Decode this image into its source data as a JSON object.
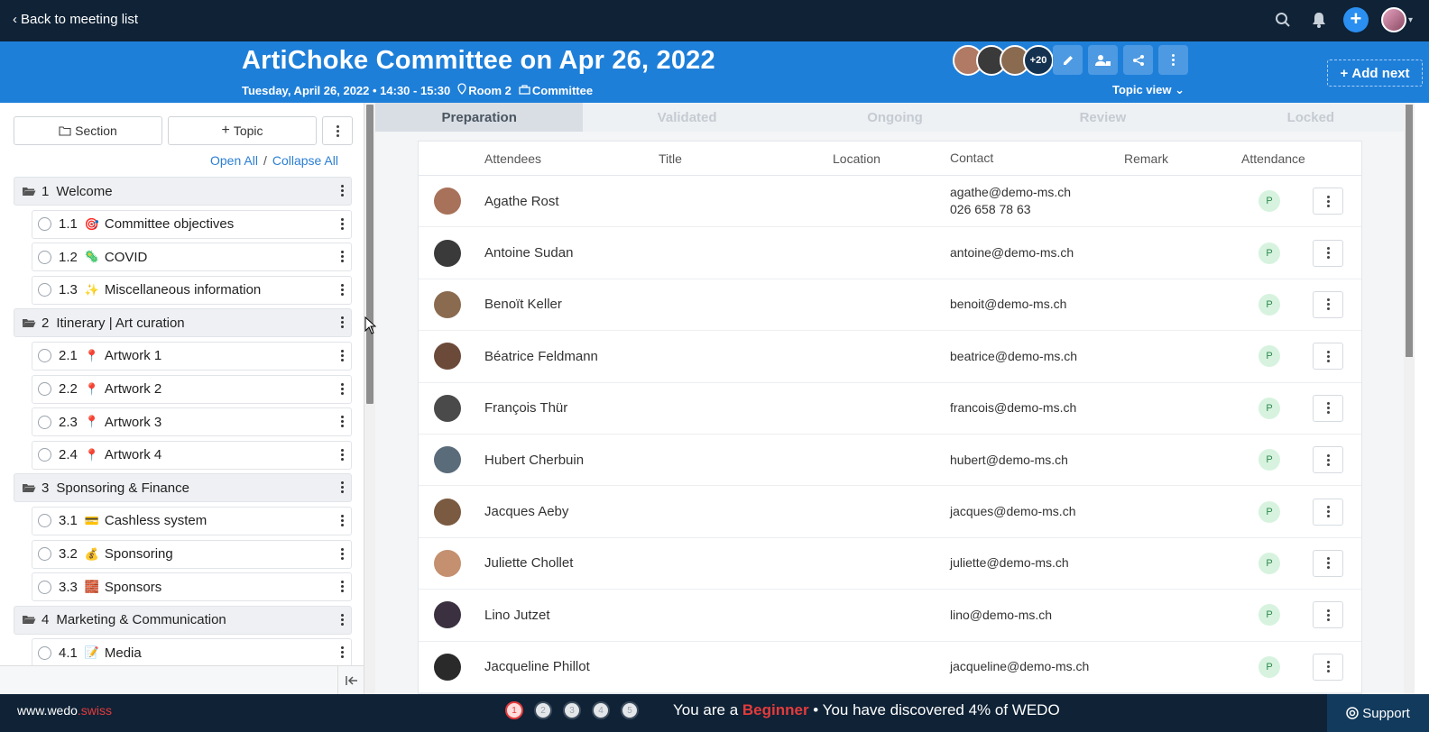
{
  "topbar": {
    "back_label": "Back to meeting list",
    "icons": [
      "search-icon",
      "bell-icon",
      "plus-icon",
      "user-avatar"
    ]
  },
  "header": {
    "title": "ArtiChoke Committee on Apr 26, 2022",
    "date_time": "Tuesday, April 26, 2022 • 14:30 - 15:30",
    "room": "Room 2",
    "category": "Committee",
    "more_attendees": "+20",
    "topic_view_label": "Topic view",
    "add_next_label": "Add next",
    "accent": "#1e7fd9"
  },
  "left": {
    "section_btn": "Section",
    "topic_btn": "Topic",
    "open_all": "Open All",
    "separator": "/",
    "collapse_all": "Collapse All",
    "tree": [
      {
        "type": "section",
        "num": "1",
        "label": "Welcome"
      },
      {
        "type": "topic",
        "num": "1.1",
        "emoji": "🎯",
        "label": "Committee objectives"
      },
      {
        "type": "topic",
        "num": "1.2",
        "emoji": "🦠",
        "label": "COVID"
      },
      {
        "type": "topic",
        "num": "1.3",
        "emoji": "✨",
        "label": "Miscellaneous information"
      },
      {
        "type": "section",
        "num": "2",
        "label": "Itinerary | Art curation"
      },
      {
        "type": "topic",
        "num": "2.1",
        "emoji": "📍",
        "label": "Artwork 1"
      },
      {
        "type": "topic",
        "num": "2.2",
        "emoji": "📍",
        "label": "Artwork 2"
      },
      {
        "type": "topic",
        "num": "2.3",
        "emoji": "📍",
        "label": "Artwork 3"
      },
      {
        "type": "topic",
        "num": "2.4",
        "emoji": "📍",
        "label": "Artwork 4"
      },
      {
        "type": "section",
        "num": "3",
        "label": "Sponsoring & Finance"
      },
      {
        "type": "topic",
        "num": "3.1",
        "emoji": "💳",
        "label": "Cashless system"
      },
      {
        "type": "topic",
        "num": "3.2",
        "emoji": "💰",
        "label": "Sponsoring"
      },
      {
        "type": "topic",
        "num": "3.3",
        "emoji": "🧱",
        "label": "Sponsors"
      },
      {
        "type": "section",
        "num": "4",
        "label": "Marketing & Communication"
      },
      {
        "type": "topic",
        "num": "4.1",
        "emoji": "📝",
        "label": "Media"
      }
    ]
  },
  "steps": [
    "Preparation",
    "Validated",
    "Ongoing",
    "Review",
    "Locked"
  ],
  "table": {
    "headers": [
      "Attendees",
      "Title",
      "Location",
      "Contact",
      "Remark",
      "Attendance"
    ],
    "rows": [
      {
        "name": "Agathe Rost",
        "email": "agathe@demo-ms.ch",
        "phone": "026 658 78 63",
        "attendance": "P"
      },
      {
        "name": "Antoine Sudan",
        "email": "antoine@demo-ms.ch",
        "phone": "",
        "attendance": "P"
      },
      {
        "name": "Benoït Keller",
        "email": "benoit@demo-ms.ch",
        "phone": "",
        "attendance": "P"
      },
      {
        "name": "Béatrice Feldmann",
        "email": "beatrice@demo-ms.ch",
        "phone": "",
        "attendance": "P"
      },
      {
        "name": "François Thür",
        "email": "francois@demo-ms.ch",
        "phone": "",
        "attendance": "P"
      },
      {
        "name": "Hubert Cherbuin",
        "email": "hubert@demo-ms.ch",
        "phone": "",
        "attendance": "P"
      },
      {
        "name": "Jacques Aeby",
        "email": "jacques@demo-ms.ch",
        "phone": "",
        "attendance": "P"
      },
      {
        "name": "Juliette Chollet",
        "email": "juliette@demo-ms.ch",
        "phone": "",
        "attendance": "P"
      },
      {
        "name": "Lino Jutzet",
        "email": "lino@demo-ms.ch",
        "phone": "",
        "attendance": "P"
      },
      {
        "name": "Jacqueline Phillot",
        "email": "jacqueline@demo-ms.ch",
        "phone": "",
        "attendance": "P"
      }
    ]
  },
  "bottom": {
    "site_prefix": "www.wedo",
    "site_suffix": ".swiss",
    "steps": [
      "1",
      "2",
      "3",
      "4",
      "5"
    ],
    "progress_prefix": "You are a ",
    "level": "Beginner",
    "progress_suffix": " • You have discovered 4% of WEDO",
    "support_label": "Support",
    "level_color": "#e43b3b"
  }
}
